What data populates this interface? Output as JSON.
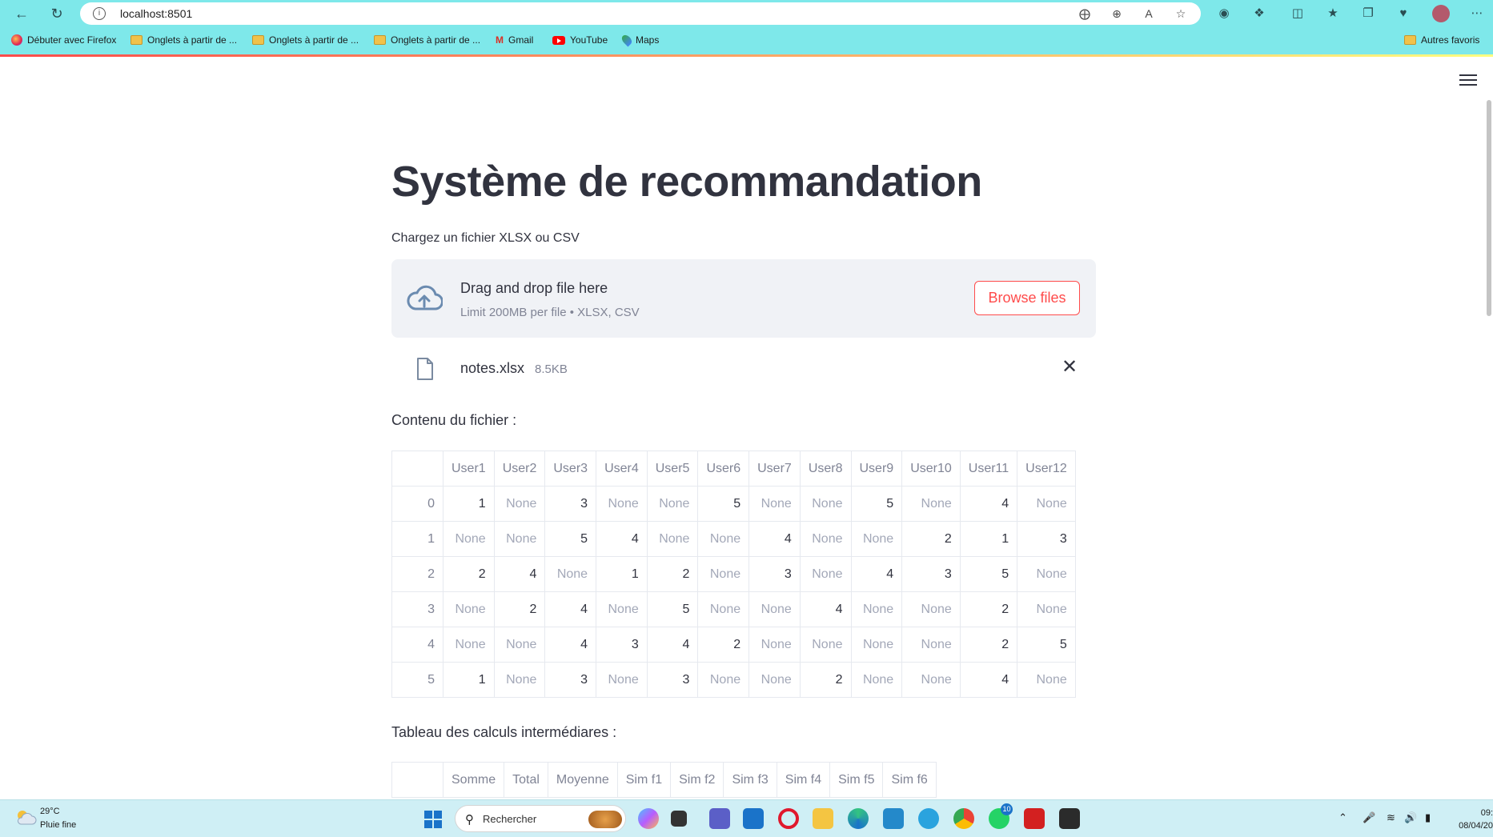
{
  "browser": {
    "url": "localhost:8501",
    "bookmarks": [
      {
        "label": "Débuter avec Firefox",
        "icon": "firefox-icon"
      },
      {
        "label": "Onglets à partir de ...",
        "icon": "folder-icon"
      },
      {
        "label": "Onglets à partir de ...",
        "icon": "folder-icon"
      },
      {
        "label": "Onglets à partir de ...",
        "icon": "folder-icon"
      },
      {
        "label": "Gmail",
        "icon": "gmail-icon"
      },
      {
        "label": "YouTube",
        "icon": "youtube-icon"
      },
      {
        "label": "Maps",
        "icon": "maps-icon"
      }
    ],
    "other_bookmarks": "Autres favoris",
    "accent_colors": {
      "toolbar": "#7ee8ea",
      "streamlit_red": "#ff4b4b"
    }
  },
  "app": {
    "title": "Système de recommandation",
    "uploader": {
      "label": "Chargez un fichier XLSX ou CSV",
      "drop_text": "Drag and drop file here",
      "limit_text": "Limit 200MB per file • XLSX, CSV",
      "browse_label": "Browse files"
    },
    "uploaded_file": {
      "name": "notes.xlsx",
      "size": "8.5KB"
    },
    "file_content_label": "Contenu du fichier :",
    "ratings_table": {
      "columns": [
        "",
        "User1",
        "User2",
        "User3",
        "User4",
        "User5",
        "User6",
        "User7",
        "User8",
        "User9",
        "User10",
        "User11",
        "User12"
      ],
      "rows": [
        [
          "0",
          "1",
          "None",
          "3",
          "None",
          "None",
          "5",
          "None",
          "None",
          "5",
          "None",
          "4",
          "None"
        ],
        [
          "1",
          "None",
          "None",
          "5",
          "4",
          "None",
          "None",
          "4",
          "None",
          "None",
          "2",
          "1",
          "3"
        ],
        [
          "2",
          "2",
          "4",
          "None",
          "1",
          "2",
          "None",
          "3",
          "None",
          "4",
          "3",
          "5",
          "None"
        ],
        [
          "3",
          "None",
          "2",
          "4",
          "None",
          "5",
          "None",
          "None",
          "4",
          "None",
          "None",
          "2",
          "None"
        ],
        [
          "4",
          "None",
          "None",
          "4",
          "3",
          "4",
          "2",
          "None",
          "None",
          "None",
          "None",
          "2",
          "5"
        ],
        [
          "5",
          "1",
          "None",
          "3",
          "None",
          "3",
          "None",
          "None",
          "2",
          "None",
          "None",
          "4",
          "None"
        ]
      ]
    },
    "intermediate_label": "Tableau des calculs intermédiares :",
    "intermediate_table": {
      "columns": [
        "",
        "Somme",
        "Total",
        "Moyenne",
        "Sim f1",
        "Sim f2",
        "Sim f3",
        "Sim f4",
        "Sim f5",
        "Sim f6"
      ]
    }
  },
  "taskbar": {
    "weather_temp": "29°C",
    "weather_desc": "Pluie fine",
    "search_placeholder": "Rechercher",
    "whatsapp_badge": "10",
    "clock_time": "09:",
    "clock_date": "08/04/20"
  }
}
